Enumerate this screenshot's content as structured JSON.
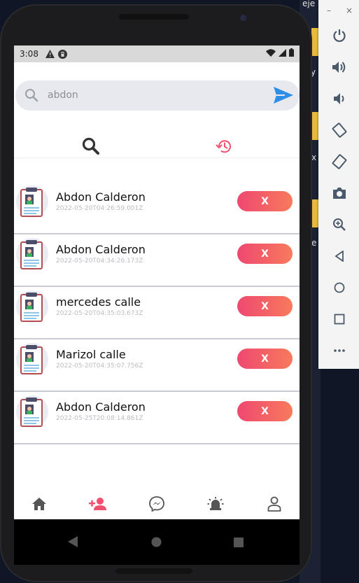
{
  "desktop": {
    "snippets": [
      "eje",
      "y",
      "x",
      "e"
    ]
  },
  "status_bar": {
    "time": "3:08"
  },
  "search": {
    "value": "abdon",
    "placeholder": ""
  },
  "tabs": [
    {
      "icon": "search-icon"
    },
    {
      "icon": "history-icon",
      "active": true
    }
  ],
  "records": [
    {
      "name": "Abdon Calderon",
      "timestamp": "2022-05-20T04:26:59.001Z",
      "delete_label": "X"
    },
    {
      "name": "Abdon Calderon",
      "timestamp": "2022-05-20T04:34:26.173Z",
      "delete_label": "X"
    },
    {
      "name": "mercedes calle",
      "timestamp": "2022-05-20T04:35:03.673Z",
      "delete_label": "X"
    },
    {
      "name": "Marizol calle",
      "timestamp": "2022-05-20T04:35:07.756Z",
      "delete_label": "X"
    },
    {
      "name": "Abdon Calderon",
      "timestamp": "2022-05-25T20:08:14.861Z",
      "delete_label": "X"
    }
  ],
  "bottom_nav": [
    {
      "icon": "home-icon"
    },
    {
      "icon": "add-user-icon",
      "active": true
    },
    {
      "icon": "messenger-icon"
    },
    {
      "icon": "alarm-bell-icon"
    },
    {
      "icon": "profile-icon"
    }
  ],
  "colors": {
    "accent": "#f0506e",
    "gradient_end": "#f77a5c",
    "send": "#2f8ee8"
  },
  "emulator_panel": {
    "minimize": "–",
    "close": "×"
  }
}
